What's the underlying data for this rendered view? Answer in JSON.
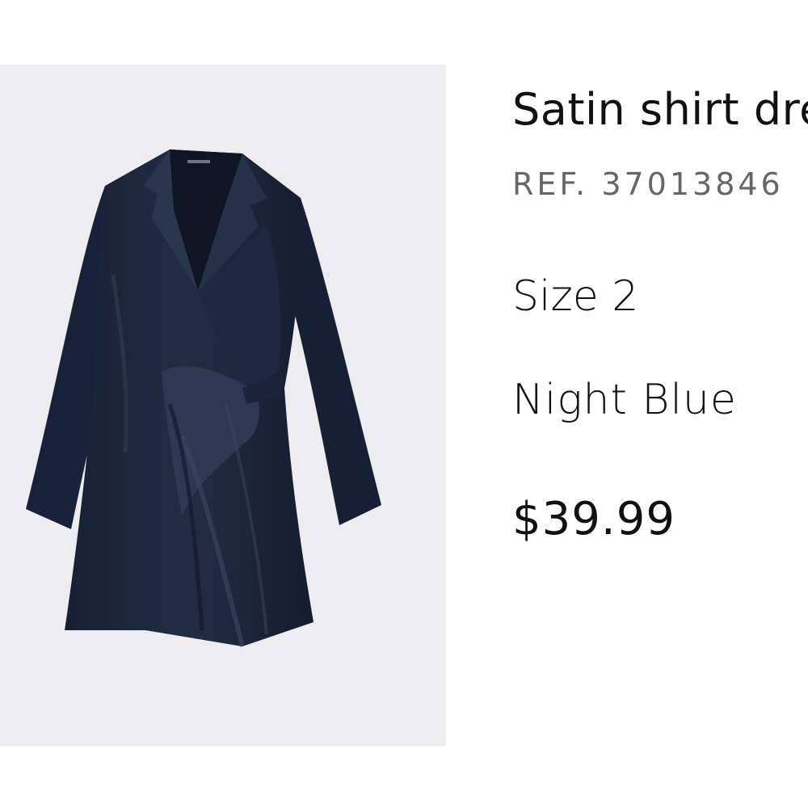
{
  "product": {
    "title": "Satin shirt dress",
    "ref": "REF. 37013846",
    "size": "Size 2",
    "color": "Night Blue",
    "price": "$39.99",
    "image_icon": "navy-satin-wrap-dress-photo"
  },
  "colors": {
    "image_background": "#ededf0",
    "dress": "#1c2538",
    "text": "#111111",
    "ref_text": "#666666"
  }
}
